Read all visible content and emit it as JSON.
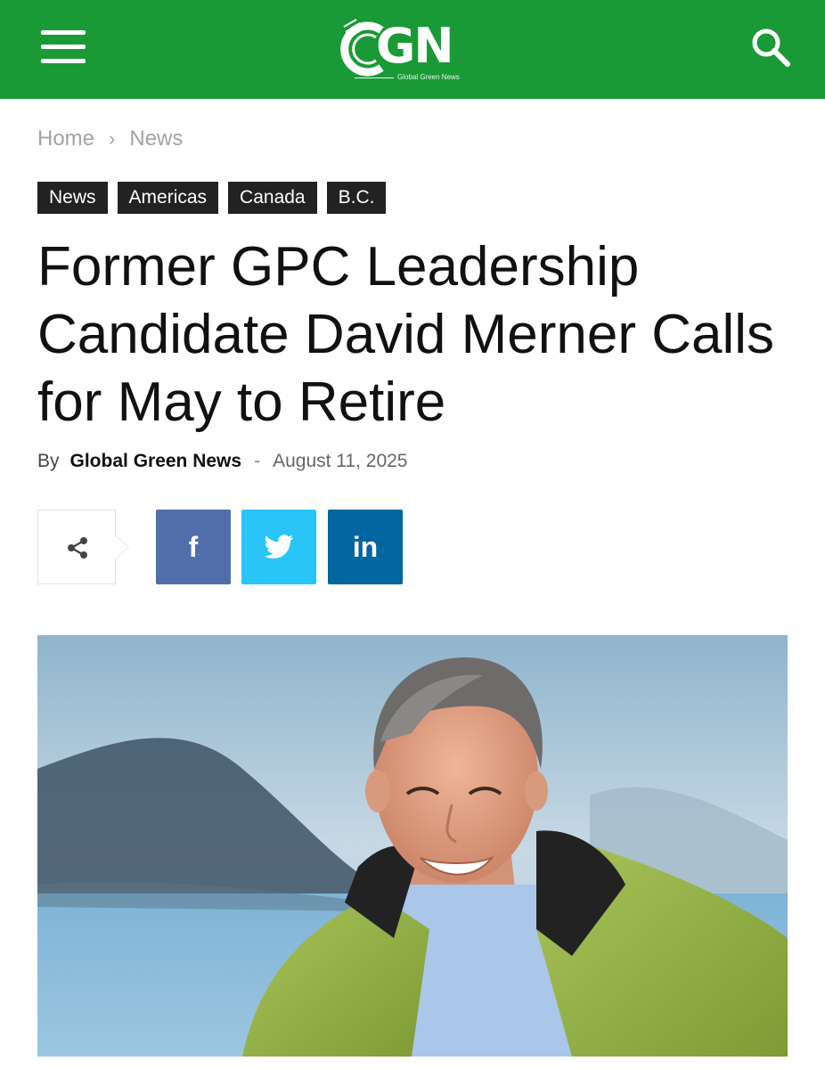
{
  "header": {
    "logo_text": "GN",
    "logo_tagline": "Global Green News",
    "bg_color": "#1a9a36"
  },
  "breadcrumb": {
    "items": [
      "Home",
      "News"
    ],
    "separator": "›"
  },
  "tags": [
    "News",
    "Americas",
    "Canada",
    "B.C."
  ],
  "article": {
    "title": "Former GPC Leadership Candidate David Merner Calls for May to Retire",
    "by_label": "By",
    "author": "Global Green News",
    "dash": "-",
    "date": "August 11, 2025"
  },
  "share": {
    "facebook_glyph": "f",
    "linkedin_glyph": "in",
    "colors": {
      "facebook": "#516eab",
      "twitter": "#29c5f6",
      "linkedin": "#0266a0"
    }
  },
  "icons": {
    "menu": "hamburger-icon",
    "search": "search-icon",
    "share": "share-icon",
    "twitter": "twitter-bird-icon"
  }
}
